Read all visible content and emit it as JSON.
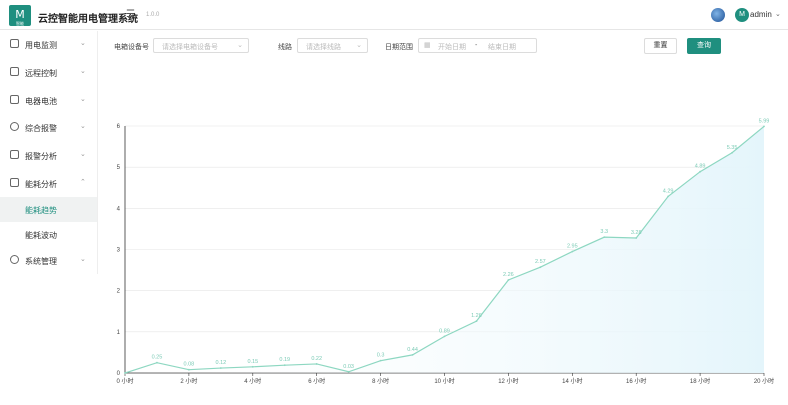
{
  "header": {
    "logo_text": "M",
    "logo_sub": "智能",
    "title": "云控智能用电管理系统",
    "version": "1.0.0",
    "menu_icon": "menu-fold-icon",
    "avatar_text": "M",
    "user": "admin"
  },
  "sidebar": {
    "items": [
      {
        "label": "用电监测",
        "icon": "monitor-icon"
      },
      {
        "label": "远程控制",
        "icon": "remote-icon"
      },
      {
        "label": "电器电池",
        "icon": "battery-icon"
      },
      {
        "label": "综合报警",
        "icon": "alarm-icon"
      },
      {
        "label": "报警分析",
        "icon": "analysis-icon"
      },
      {
        "label": "能耗分析",
        "icon": "energy-icon"
      },
      {
        "label": "系统管理",
        "icon": "gear-icon"
      }
    ],
    "subitems": [
      {
        "label": "能耗趋势",
        "active": true
      },
      {
        "label": "能耗波动",
        "active": false
      }
    ]
  },
  "filters": {
    "device_label": "电箱设备号",
    "device_placeholder": "请选择电箱设备号",
    "line_label": "线路",
    "line_placeholder": "请选择线路",
    "date_label": "日期范围",
    "start_placeholder": "开始日期",
    "date_sep": "-",
    "end_placeholder": "结束日期",
    "reset": "重置",
    "query": "查询"
  },
  "colors": {
    "accent": "#1f8f7f",
    "line": "#8dd7c1",
    "area": "#e4f5fb"
  },
  "chart_data": {
    "type": "area",
    "x": [
      "0小时",
      "1小时",
      "2小时",
      "3小时",
      "4小时",
      "5小时",
      "6小时",
      "7小时",
      "8小时",
      "9小时",
      "10小时",
      "11小时",
      "12小时",
      "13小时",
      "14小时",
      "15小时",
      "16小时",
      "17小时",
      "18小时",
      "19小时",
      "20小时"
    ],
    "x_tick_labels": [
      "0 小时",
      "2 小时",
      "4 小时",
      "6 小时",
      "8 小时",
      "10 小时",
      "12 小时",
      "14 小时",
      "16 小时",
      "18 小时",
      "20 小时"
    ],
    "values": [
      0,
      0.25,
      0.08,
      0.12,
      0.15,
      0.19,
      0.22,
      0.03,
      0.3,
      0.44,
      0.89,
      1.26,
      2.26,
      2.57,
      2.95,
      3.3,
      3.28,
      4.29,
      4.89,
      5.35,
      5.99
    ],
    "data_labels": [
      "",
      "0.25",
      "0.08",
      "0.12",
      "0.15",
      "0.19",
      "0.22",
      "0.03",
      "0.3",
      "0.44",
      "0.89",
      "1.26",
      "2.26",
      "2.57",
      "2.95",
      "3.3",
      "3.28",
      "4.29",
      "4.89",
      "5.35",
      "5.99"
    ],
    "ylim": [
      0,
      6
    ],
    "y_ticks": [
      "0",
      "1",
      "2",
      "3",
      "4",
      "5",
      "6"
    ],
    "grid": true,
    "title": "",
    "xlabel": "",
    "ylabel": ""
  }
}
